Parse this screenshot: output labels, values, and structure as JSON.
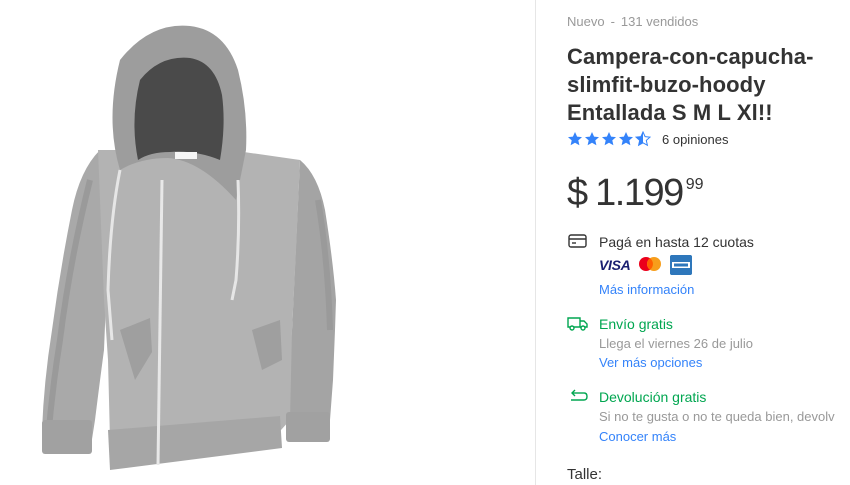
{
  "product": {
    "condition": "Nuevo",
    "separator": "-",
    "sold": "131 vendidos",
    "title": "Campera-con-capucha-slimfit-buzo-hoody Entallada S M L Xl!!",
    "rating_value": 4.5,
    "reviews": "6 opiniones",
    "price": {
      "currency": "$",
      "integer": "1.199",
      "cents": "99"
    }
  },
  "payment": {
    "installments": "Pagá en hasta 12 cuotas",
    "card_visa": "VISA",
    "more_info": "Más información"
  },
  "shipping": {
    "title": "Envío gratis",
    "arrival": "Llega el viernes 26 de julio",
    "more_options": "Ver más opciones"
  },
  "returns": {
    "title": "Devolución gratis",
    "detail": "Si no te gusta o no te queda bien, devolv",
    "learn_more": "Conocer más"
  },
  "size": {
    "label": "Talle:"
  },
  "colors": {
    "link": "#3483fa",
    "success": "#00a650",
    "star": "#3483fa"
  }
}
